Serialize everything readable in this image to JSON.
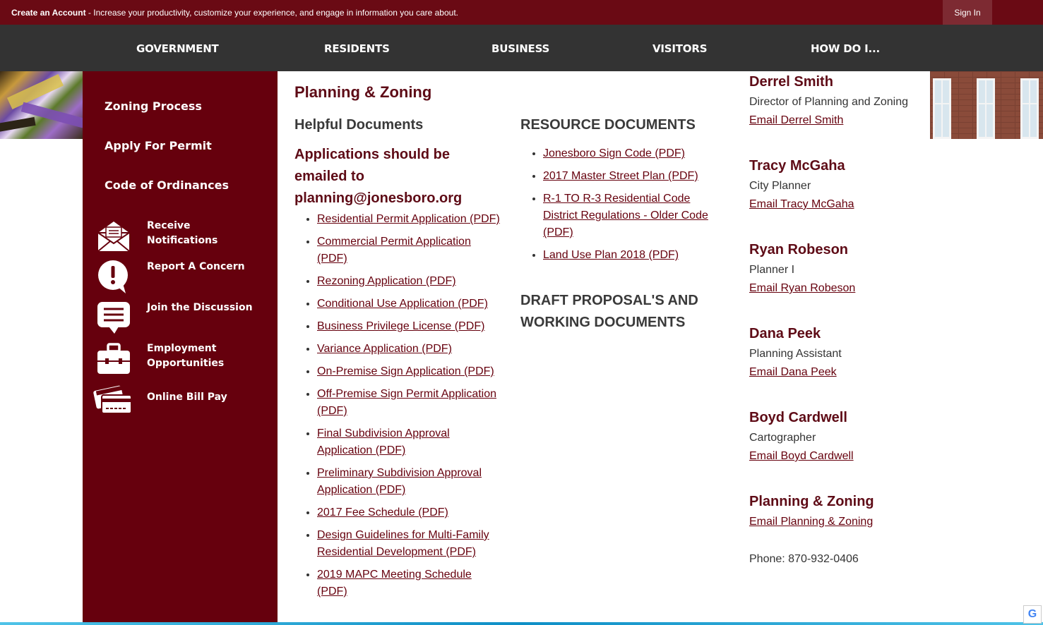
{
  "topbar": {
    "promo_bold": "Create an Account",
    "promo_text": " - Increase your productivity, customize your experience, and engage in information you care about.",
    "signin_label": "Sign In"
  },
  "nav": [
    "GOVERNMENT",
    "RESIDENTS",
    "BUSINESS",
    "VISITORS",
    "HOW DO I..."
  ],
  "sidebar": {
    "links": [
      "Zoning Process",
      "Apply For Permit",
      "Code of Ordinances"
    ],
    "quick_links": [
      {
        "label": "Receive Notifications",
        "icon": "envelope-icon"
      },
      {
        "label": "Report A Concern",
        "icon": "alert-bubble-icon"
      },
      {
        "label": "Join the Discussion",
        "icon": "chat-icon"
      },
      {
        "label": "Employment Opportunities",
        "icon": "briefcase-icon"
      },
      {
        "label": "Online Bill Pay",
        "icon": "credit-cards-icon"
      }
    ]
  },
  "main": {
    "title": "Planning & Zoning",
    "helpful_heading": "Helpful Documents",
    "applications_note": " Applications should be emailed to planning@jonesboro.org",
    "applications": [
      "Residential Permit Application (PDF)",
      "Commercial Permit Application (PDF)",
      "Rezoning Application (PDF)",
      "Conditional Use Application (PDF)",
      "Business Privilege License (PDF)",
      "Variance Application (PDF)",
      "On-Premise Sign Application (PDF)",
      "Off-Premise Sign Permit Application (PDF)",
      "Final Subdivision Approval Application (PDF)",
      "Preliminary Subdivision Approval Application (PDF)",
      "2017 Fee Schedule (PDF)",
      "Design Guidelines for Multi-Family Residential Development (PDF)",
      "2019 MAPC Meeting Schedule (PDF)"
    ],
    "resource_heading": "RESOURCE DOCUMENTS",
    "resources": [
      "Jonesboro Sign Code (PDF)",
      "2017 Master Street Plan (PDF)",
      "R-1 TO R-3 Residential Code District Regulations - Older Code (PDF)",
      "Land Use Plan 2018 (PDF)"
    ],
    "draft_heading": "DRAFT PROPOSAL'S AND WORKING DOCUMENTS"
  },
  "contacts": [
    {
      "name": "Derrel Smith",
      "title": "Director of Planning and Zoning",
      "email": "Email Derrel Smith"
    },
    {
      "name": "Tracy McGaha",
      "title": "City Planner",
      "email": "Email Tracy McGaha"
    },
    {
      "name": "Ryan Robeson",
      "title": "Planner I",
      "email": "Email Ryan Robeson"
    },
    {
      "name": "Dana Peek",
      "title": "Planning Assistant",
      "email": "Email Dana Peek"
    },
    {
      "name": "Boyd Cardwell",
      "title": "Cartographer",
      "email": "Email Boyd Cardwell"
    },
    {
      "name": "Planning & Zoning",
      "title": "",
      "email": "Email Planning & Zoning"
    }
  ],
  "phone": "Phone: 870-932-0406",
  "translate_badge": "G",
  "colors": {
    "brand": "#66000d",
    "nav": "#333333",
    "accent_line": "#0e8fc6"
  }
}
